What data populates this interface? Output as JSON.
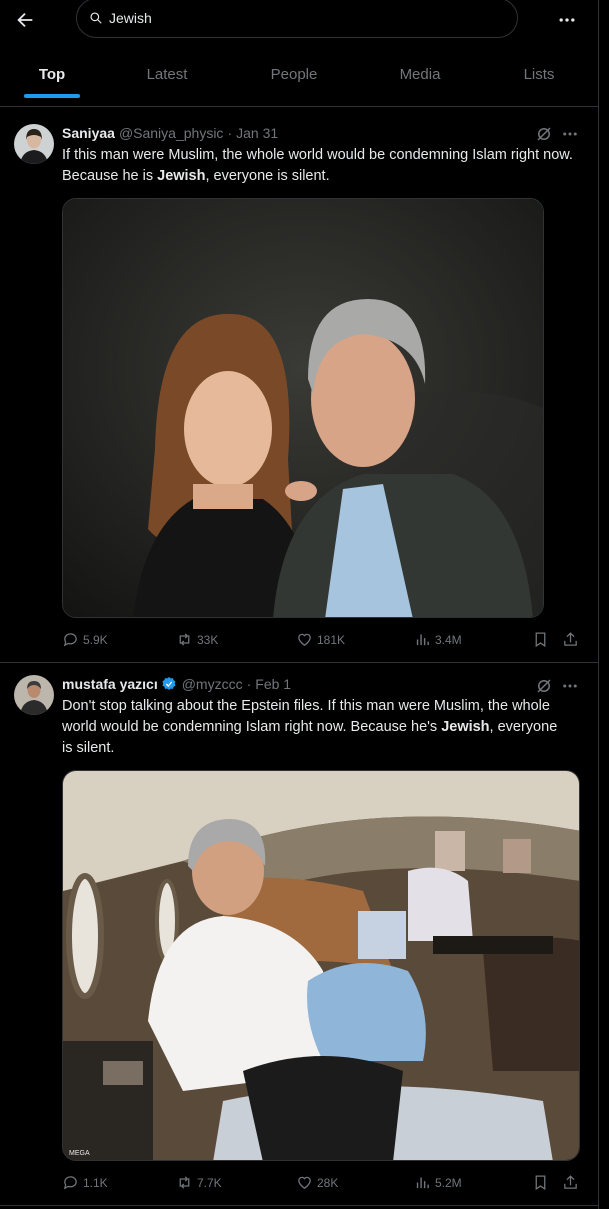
{
  "search": {
    "query": "Jewish"
  },
  "tabs": [
    {
      "label": "Top",
      "active": true
    },
    {
      "label": "Latest",
      "active": false
    },
    {
      "label": "People",
      "active": false
    },
    {
      "label": "Media",
      "active": false
    },
    {
      "label": "Lists",
      "active": false
    }
  ],
  "colors": {
    "accent": "#1d9bf0",
    "background": "#000000",
    "muted": "#71767b",
    "text": "#e7e9ea",
    "border": "#2f3336"
  },
  "tweets": [
    {
      "name": "Saniyaa",
      "handle": "@Saniya_physic",
      "date": "Jan 31",
      "verified": false,
      "text_parts": [
        "If this man were Muslim, the whole world would be condemning Islam right now. Because he is ",
        "Jewish",
        ", everyone is silent."
      ],
      "replies": "5.9K",
      "reposts": "33K",
      "likes": "181K",
      "views": "3.4M"
    },
    {
      "name": "mustafa yazıcı",
      "handle": "@myzccc",
      "date": "Feb 1",
      "verified": true,
      "text_parts": [
        "Don't stop talking about the Epstein files. If this man were Muslim, the whole world would be condemning Islam right now. Because he's ",
        "Jewish",
        ", everyone is silent."
      ],
      "replies": "1.1K",
      "reposts": "7.7K",
      "likes": "28K",
      "views": "5.2M"
    }
  ],
  "icons": {
    "back": "arrow-left-icon",
    "search": "search-icon",
    "more": "more-dots-icon",
    "grok": "grok-icon",
    "reply": "reply-icon",
    "repost": "repost-icon",
    "like": "heart-icon",
    "views": "views-icon",
    "bookmark": "bookmark-icon",
    "share": "share-icon"
  }
}
